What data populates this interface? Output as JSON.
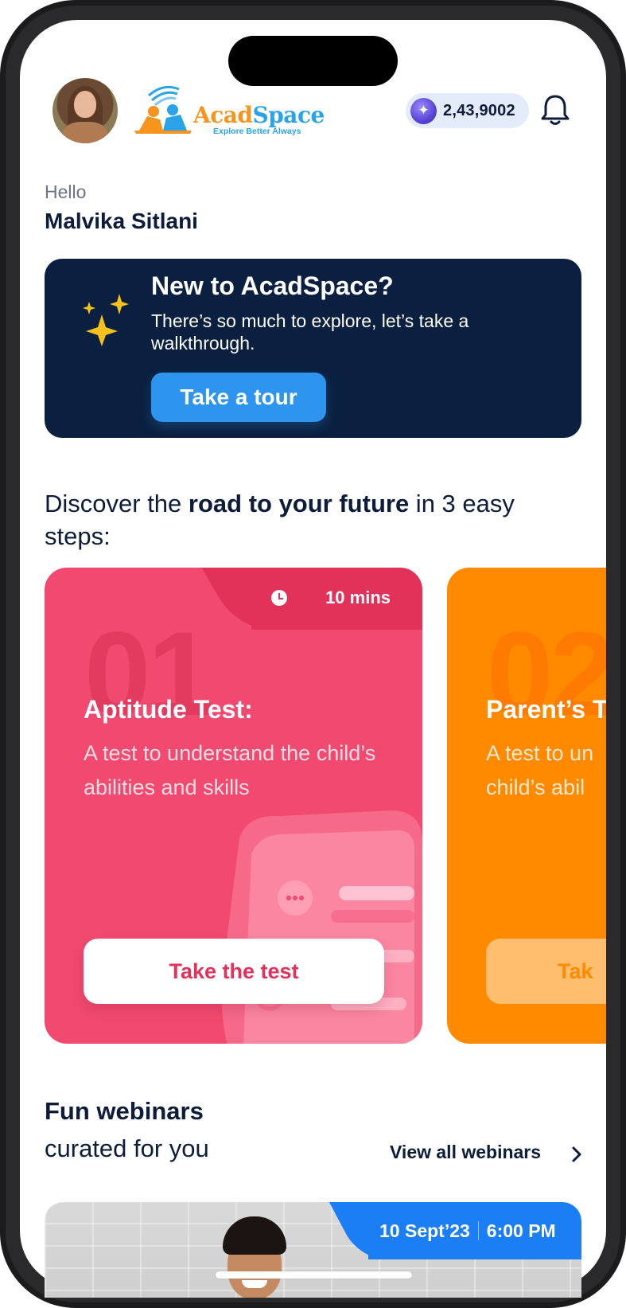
{
  "header": {
    "logo_title_part1": "Acad",
    "logo_title_part2": "Space",
    "logo_tagline": "Explore Better Always",
    "coins": "2,43,9002",
    "colors": {
      "logo_orange": "#f7941d",
      "logo_blue": "#2aa3e8"
    }
  },
  "greeting": {
    "hello": "Hello",
    "name": "Malvika Sitlani"
  },
  "tour_banner": {
    "title": "New to AcadSpace?",
    "description": "There’s so much to explore, let’s take a walkthrough.",
    "button": "Take a tour",
    "icon": "sparkles-icon",
    "colors": {
      "background": "#0b2040",
      "button": "#2e95ef"
    }
  },
  "discover": {
    "prefix": "Discover the ",
    "emphasis": "road to your future",
    "suffix": " in 3 easy steps:"
  },
  "steps": [
    {
      "number": "01",
      "duration": "10 mins",
      "title": "Aptitude Test:",
      "description": "A test to understand the child’s abilities and skills",
      "button": "Take the test",
      "color": "#f1496f"
    },
    {
      "number": "02",
      "title": "Parent’s T",
      "description_line1": "A test to un",
      "description_line2": "child’s abil",
      "button": "Tak",
      "color": "#ff8a00"
    }
  ],
  "webinars": {
    "title": "Fun webinars",
    "subtitle": "curated for you",
    "view_all": "View all webinars",
    "card": {
      "date": "10 Sept’23",
      "time": "6:00 PM",
      "accent": "#1b7ef5"
    }
  }
}
